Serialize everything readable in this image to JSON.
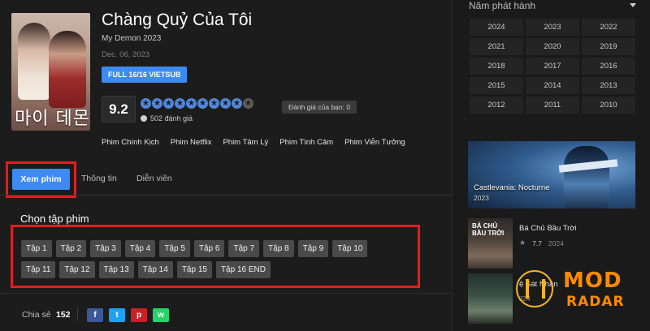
{
  "movie": {
    "title": "Chàng Quỷ Của Tôi",
    "subtitle": "My Demon 2023",
    "date": "Dec. 06, 2023",
    "badge": "FULL 16/16 VIETSUB",
    "poster_text": "마이 데몬",
    "score": "9.2",
    "stars_total": 10,
    "stars_filled": 9,
    "votes": "502 đánh giá",
    "your_rating": "Đánh giá của bạn: 0",
    "genres": [
      "Phim Chính Kịch",
      "Phim Netflix",
      "Phim Tâm Lý",
      "Phim Tình Cảm",
      "Phim Viễn Tưởng"
    ]
  },
  "tabs": {
    "watch": "Xem phim",
    "info": "Thông tin",
    "cast": "Diễn viên"
  },
  "episodes": {
    "heading": "Chọn tập phim",
    "list": [
      "Tập 1",
      "Tập 2",
      "Tập 3",
      "Tập 4",
      "Tập 5",
      "Tập 6",
      "Tập 7",
      "Tập 8",
      "Tập 9",
      "Tập 10",
      "Tập 11",
      "Tập 12",
      "Tập 13",
      "Tập 14",
      "Tập 15",
      "Tập 16 END"
    ]
  },
  "share": {
    "label": "Chia sẻ",
    "count": "152",
    "buttons": [
      {
        "name": "facebook",
        "glyph": "f",
        "color": "#3b5998"
      },
      {
        "name": "twitter",
        "glyph": "t",
        "color": "#1da1f2"
      },
      {
        "name": "pinterest",
        "glyph": "p",
        "color": "#cb2027"
      },
      {
        "name": "whatsapp",
        "glyph": "w",
        "color": "#25d366"
      }
    ]
  },
  "sidebar": {
    "year_heading": "Năm phát hành",
    "years": [
      "2024",
      "2023",
      "2022",
      "2021",
      "2020",
      "2019",
      "2018",
      "2017",
      "2016",
      "2015",
      "2014",
      "2013",
      "2012",
      "2011",
      "2010"
    ],
    "featured": {
      "title": "Castlevania: Nocturne",
      "year": "2023"
    },
    "items": [
      {
        "thumb_text": "BÁ CHỦ BẦU TRỜI",
        "name": "Bá Chủ Bầu Trời",
        "rating": "7.7",
        "year": "2024"
      },
      {
        "name": "ệ Sát Nhân",
        "year": "J24"
      }
    ]
  },
  "watermark": {
    "top": "MOD",
    "bottom": "RADAR"
  }
}
